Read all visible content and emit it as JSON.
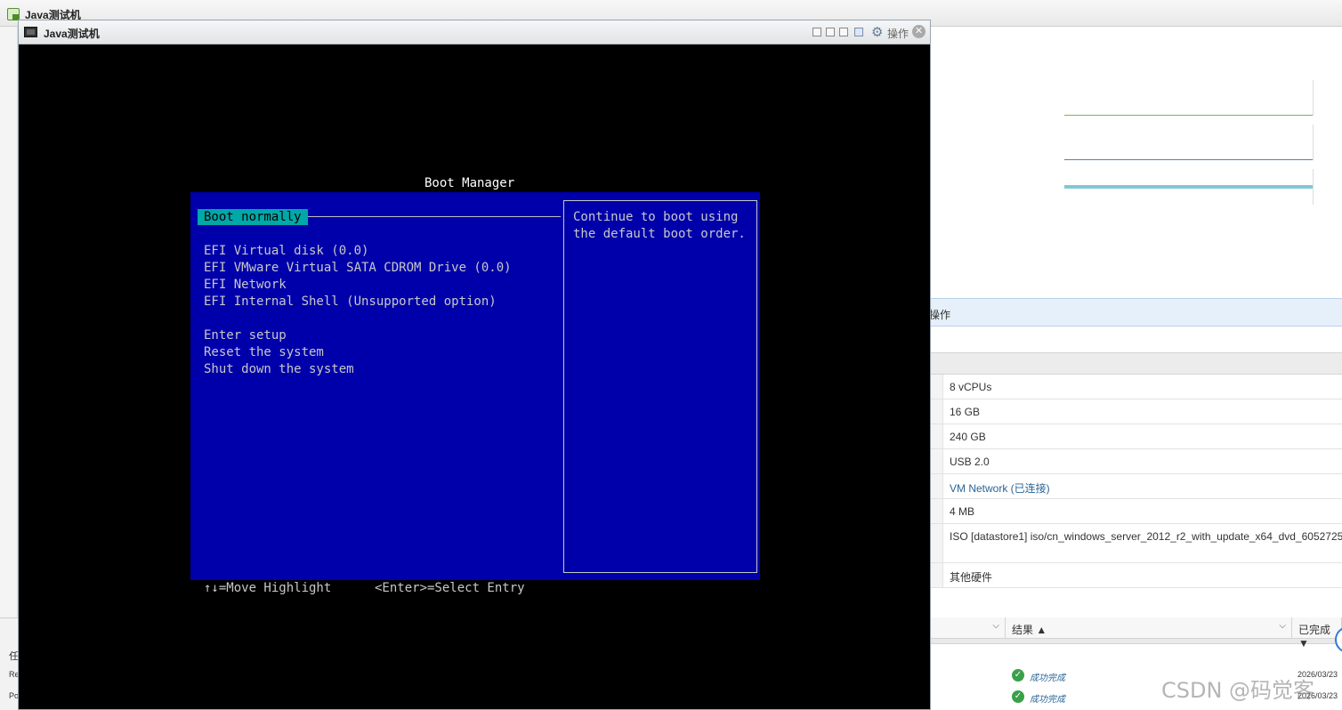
{
  "host": {
    "title": "Java测试机",
    "ops_label": "操作",
    "hardware": [
      {
        "value": "8 vCPUs",
        "link": false
      },
      {
        "value": "16 GB",
        "link": false
      },
      {
        "value": "240 GB",
        "link": false
      },
      {
        "value": "USB 2.0",
        "link": false
      },
      {
        "value": "VM Network (已连接)",
        "link": true
      },
      {
        "value": "4 MB",
        "link": false
      },
      {
        "value": "ISO [datastore1] iso/cn_windows_server_2012_r2_with_update_x64_dvd_6052725",
        "link": false
      },
      {
        "value": "其他硬件",
        "link": false
      }
    ],
    "tasks": {
      "columns": {
        "result": "结果 ▲",
        "completed": "已完成 ▼"
      },
      "rows": [
        {
          "status": "成功完成",
          "date": "2026/03/23"
        },
        {
          "status": "成功完成",
          "date": "2026/03/23"
        }
      ],
      "left_labels": [
        "任",
        "Re",
        "Po"
      ]
    },
    "watermark": "CSDN @码觉客"
  },
  "vm_window": {
    "title": "Java测试机",
    "ops_label": "操作",
    "close_glyph": "✕",
    "gear_glyph": "⚙"
  },
  "boot_manager": {
    "title": "Boot Manager",
    "selected": "Boot normally",
    "devices": [
      "EFI Virtual disk (0.0)",
      "EFI VMware Virtual SATA CDROM Drive (0.0)",
      "EFI Network",
      "EFI Internal Shell (Unsupported option)"
    ],
    "actions": [
      "Enter setup",
      "Reset the system",
      "Shut down the system"
    ],
    "help_lines": [
      "Continue to boot using",
      "the default boot order."
    ],
    "footer_left": "↑↓=Move Highlight",
    "footer_right": "<Enter>=Select Entry"
  },
  "colors": {
    "efi_blue": "#0000aa",
    "efi_highlight": "#00a8a8",
    "efi_text": "#c8c8c8"
  }
}
